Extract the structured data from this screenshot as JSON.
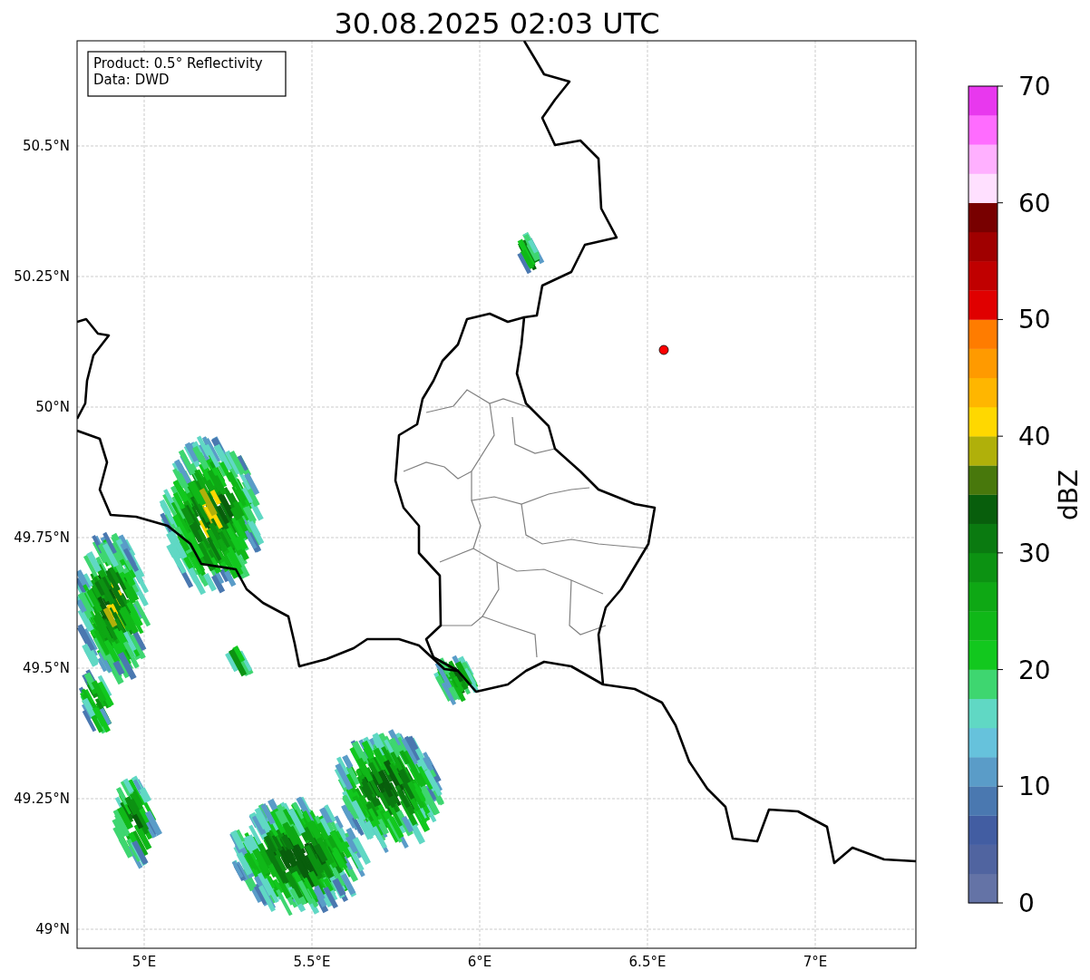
{
  "title": "30.08.2025 02:03 UTC",
  "info_box": {
    "lines": [
      "Product: 0.5° Reflectivity",
      "Data: DWD"
    ]
  },
  "map": {
    "y_ticks": [
      "50.5°N",
      "50.25°N",
      "50°N",
      "49.75°N",
      "49.5°N",
      "49.25°N",
      "49°N"
    ],
    "x_ticks": [
      "5°E",
      "5.5°E",
      "6°E",
      "6.5°E",
      "7°E"
    ]
  },
  "colorbar": {
    "label": "dBZ",
    "ticks": [
      "70",
      "60",
      "50",
      "40",
      "30",
      "20",
      "10",
      "0"
    ],
    "bins": [
      {
        "color": "#6473a6"
      },
      {
        "color": "#5064a0"
      },
      {
        "color": "#425da2"
      },
      {
        "color": "#4a78b0"
      },
      {
        "color": "#5a9cc8"
      },
      {
        "color": "#66c2dc"
      },
      {
        "color": "#60d8c4"
      },
      {
        "color": "#3ed670"
      },
      {
        "color": "#12c81e"
      },
      {
        "color": "#10b818"
      },
      {
        "color": "#0ea814"
      },
      {
        "color": "#0c9212"
      },
      {
        "color": "#0a7a10"
      },
      {
        "color": "#085e0c"
      },
      {
        "color": "#48780c"
      },
      {
        "color": "#b0b00a"
      },
      {
        "color": "#ffd800"
      },
      {
        "color": "#ffb600"
      },
      {
        "color": "#ff9a00"
      },
      {
        "color": "#ff7c00"
      },
      {
        "color": "#e00000"
      },
      {
        "color": "#c00000"
      },
      {
        "color": "#a00000"
      },
      {
        "color": "#780000"
      },
      {
        "color": "#ffe0ff"
      },
      {
        "color": "#ffb0ff"
      },
      {
        "color": "#ff6cff"
      },
      {
        "color": "#e838ee"
      }
    ]
  }
}
